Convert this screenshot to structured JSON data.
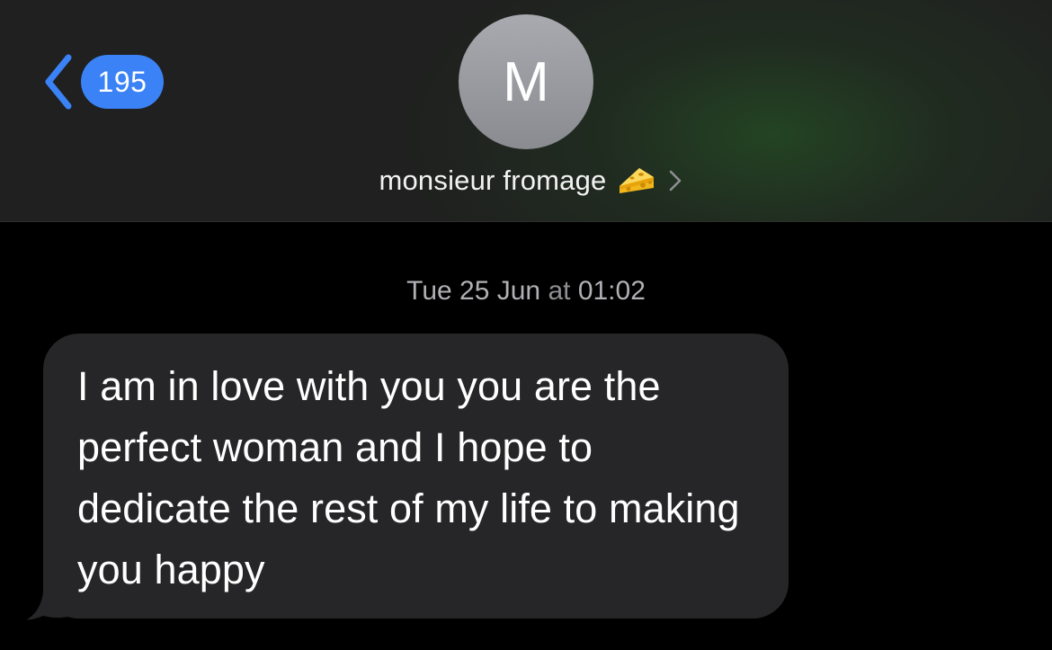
{
  "header": {
    "back": {
      "unread_count": "195"
    },
    "contact": {
      "avatar_initial": "M",
      "name": "monsieur fromage",
      "emoji_icon": "cheese-icon"
    }
  },
  "conversation": {
    "timestamp_day": "Tue 25 Jun",
    "timestamp_sep": " at ",
    "timestamp_time": "01:02",
    "messages": [
      {
        "direction": "incoming",
        "text": "I am in love with you you are the perfect woman and I hope to dedicate the rest of my life to making you happy"
      }
    ]
  },
  "colors": {
    "accent": "#3b82f6",
    "incoming_bubble": "#262628",
    "background": "#000000",
    "avatar": "#9b9ca1"
  }
}
